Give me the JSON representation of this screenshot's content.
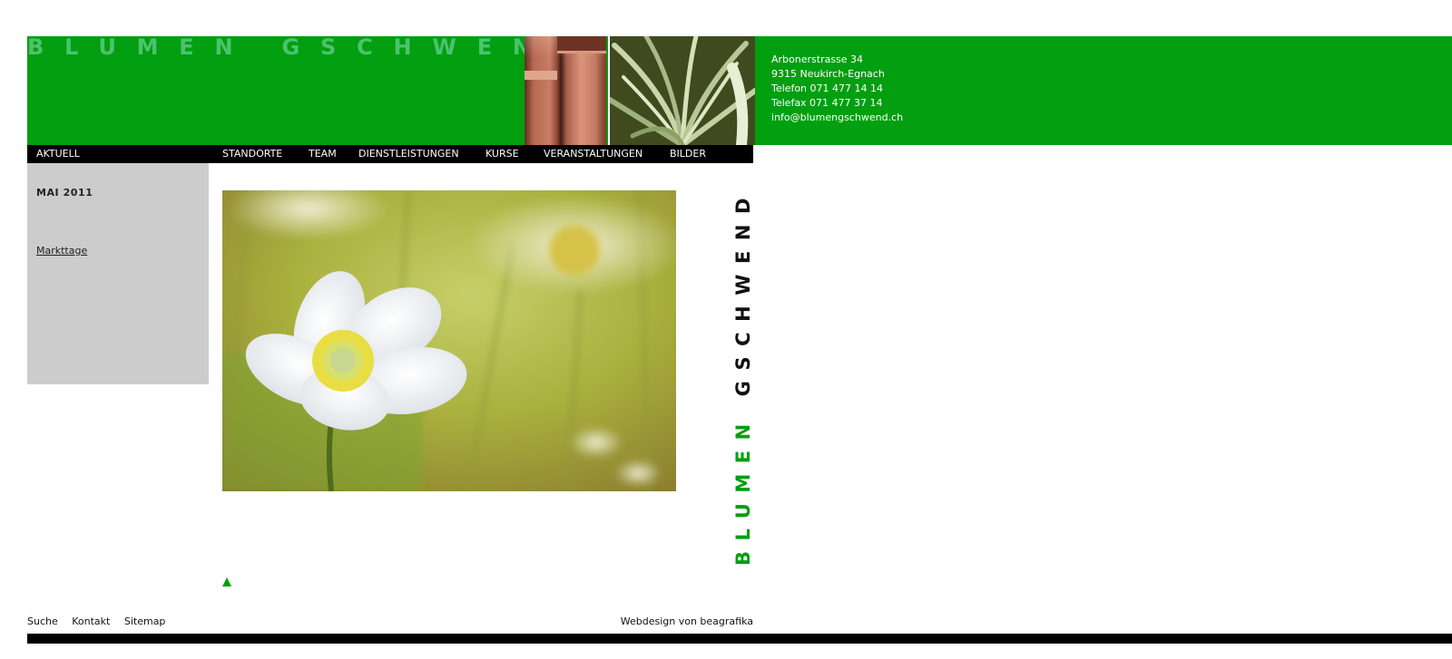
{
  "brand": {
    "logo_text": "BLUMEN GSCHWEND",
    "vertical_green": "BLUMEN",
    "vertical_black": "GSCHWEND",
    "green": "#029f10"
  },
  "contact": {
    "street": "Arbonerstrasse 34",
    "city": "9315 Neukirch-Egnach",
    "phone": "Telefon 071 477 14 14",
    "fax": "Telefax 071 477 37 14",
    "email": "info@blumengschwend.ch"
  },
  "nav": {
    "items": [
      {
        "label": "AKTUELL",
        "active": true
      },
      {
        "label": "STANDORTE"
      },
      {
        "label": "TEAM"
      },
      {
        "label": "DIENSTLEISTUNGEN"
      },
      {
        "label": "KURSE"
      },
      {
        "label": "VERANSTALTUNGEN"
      },
      {
        "label": "BILDER"
      }
    ]
  },
  "sidebar": {
    "date": "MAI 2011",
    "link": "Markttage"
  },
  "icons": {
    "back_to_top": "triangle-up-icon"
  },
  "footer": {
    "links": [
      "Suche",
      "Kontakt",
      "Sitemap"
    ],
    "credit": "Webdesign von beagrafika"
  }
}
